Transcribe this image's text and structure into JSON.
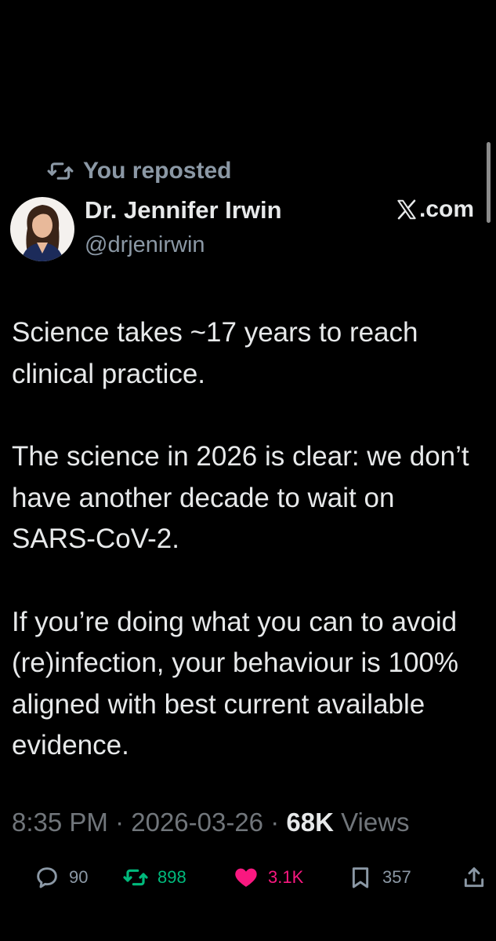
{
  "repost_label": "You reposted",
  "author": {
    "name": "Dr. Jennifer Irwin",
    "handle": "@drjenirwin"
  },
  "brand": ".com",
  "tweet": {
    "paragraphs": [
      "Science takes ~17 years to reach clinical practice.",
      "The science in 2026 is clear: we don’t have another decade to wait on SARS-CoV-2.",
      "If you’re doing what you can to avoid (re)infection, your behaviour is 100% aligned with best current available evidence."
    ]
  },
  "meta": {
    "time": "8:35 PM",
    "sep1": " · ",
    "date": "2026-03-26",
    "sep2": " · ",
    "views_count": "68K",
    "views_label": " Views"
  },
  "actions": {
    "reply_count": "90",
    "repost_count": "898",
    "like_count": "3.1K",
    "bookmark_count": "357"
  },
  "colors": {
    "background": "#000000",
    "text": "#e7e9ea",
    "secondary": "#8b98a5",
    "repost_active": "#00ba7c",
    "like_active": "#f91880"
  },
  "icons": [
    "repost-icon",
    "x-logo-icon",
    "reply-icon",
    "heart-icon",
    "bookmark-icon",
    "share-icon"
  ]
}
